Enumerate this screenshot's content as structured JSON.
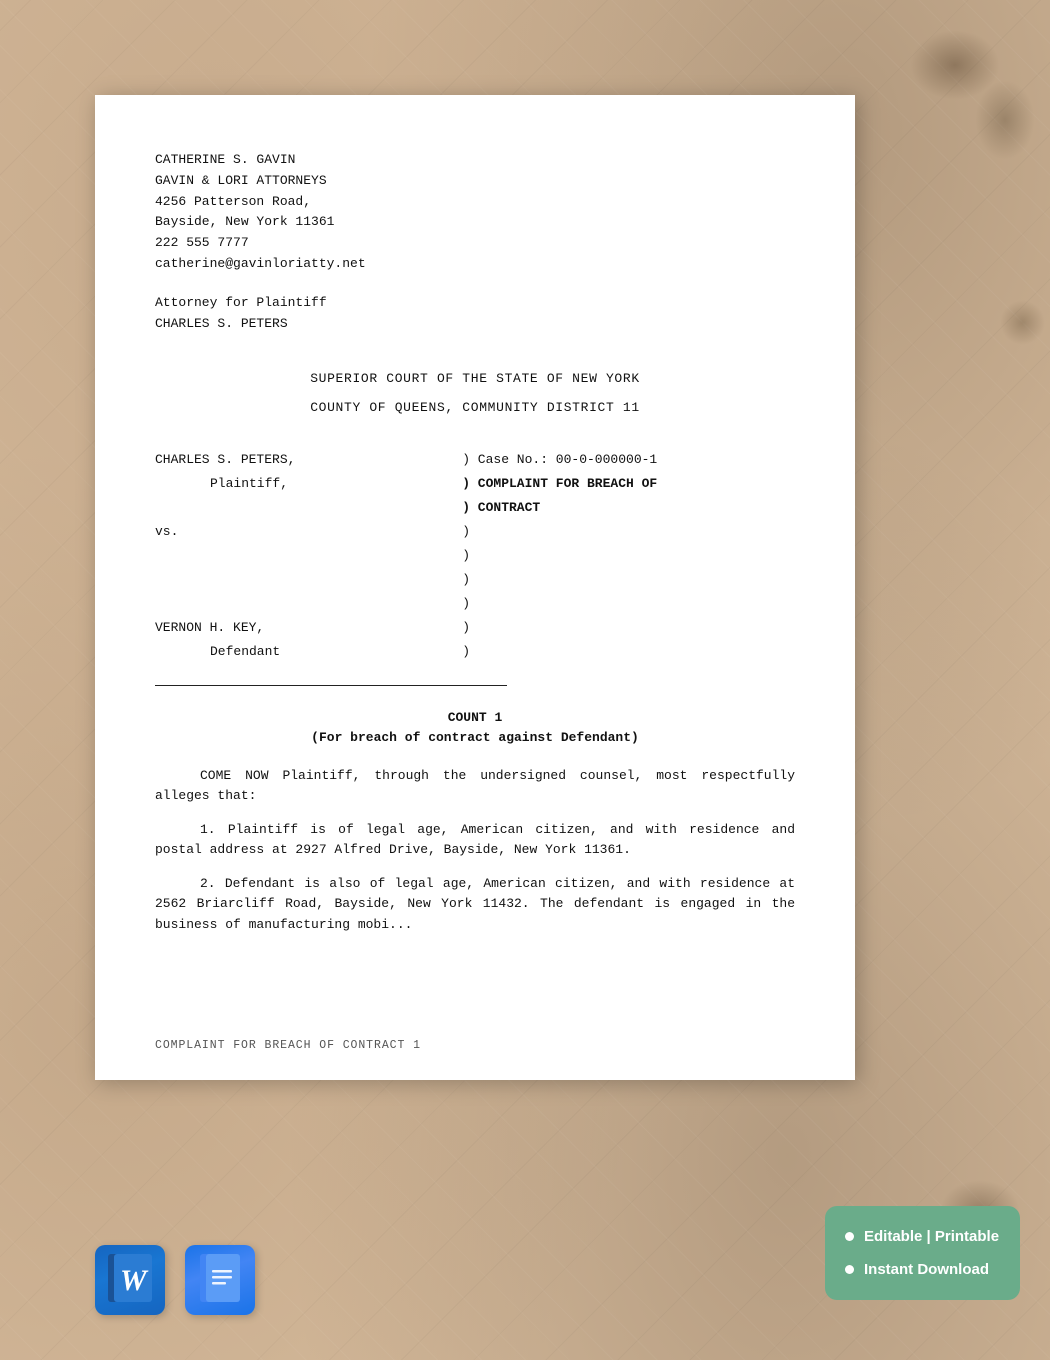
{
  "background": {
    "color": "#d4b99a"
  },
  "attorney": {
    "name": "CATHERINE S. GAVIN",
    "firm": "GAVIN & LORI ATTORNEYS",
    "address_line1": "4256 Patterson Road,",
    "address_line2": "Bayside, New York 11361",
    "phone": "222 555 7777",
    "email": "catherine@gavinloriatty.net",
    "role_label": "Attorney for Plaintiff",
    "client_name": "CHARLES S. PETERS"
  },
  "court": {
    "name": "SUPERIOR COURT OF THE STATE OF NEW YORK",
    "county": "COUNTY OF QUEENS, COMMUNITY DISTRICT 11"
  },
  "case": {
    "plaintiff_name": "CHARLES S. PETERS,",
    "plaintiff_role": "Plaintiff,",
    "vs": "vs.",
    "defendant_name": "VERNON H. KEY,",
    "defendant_role": "Defendant",
    "case_number_label": ") Case No.: 00-0-000000-1",
    "paren1": ")",
    "complaint_label1": ") COMPLAINT FOR BREACH OF",
    "complaint_label2": ") CONTRACT",
    "paren2": ")",
    "paren3": ")",
    "paren4": ")",
    "paren5": ")",
    "paren6": ")",
    "paren7": ")"
  },
  "count": {
    "title": "COUNT 1",
    "subtitle": "(For breach of contract against Defendant)"
  },
  "body": {
    "intro": "COME NOW Plaintiff, through the undersigned counsel, most respectfully alleges that:",
    "para1": "1.  Plaintiff is of legal age, American citizen, and with residence and postal address at 2927 Alfred Drive, Bayside, New York 11361.",
    "para2": "2.  Defendant is also of legal age, American citizen, and with residence at 2562 Briarcliff Road, Bayside, New York 11432. The defendant is engaged in the business of manufacturing mobi..."
  },
  "footer": {
    "label": "COMPLAINT FOR BREACH OF CONTRACT 1"
  },
  "badge": {
    "item1": "Editable | Printable",
    "item2": "Instant Download"
  },
  "icons": {
    "word_label": "Microsoft Word",
    "docs_label": "Google Docs"
  }
}
